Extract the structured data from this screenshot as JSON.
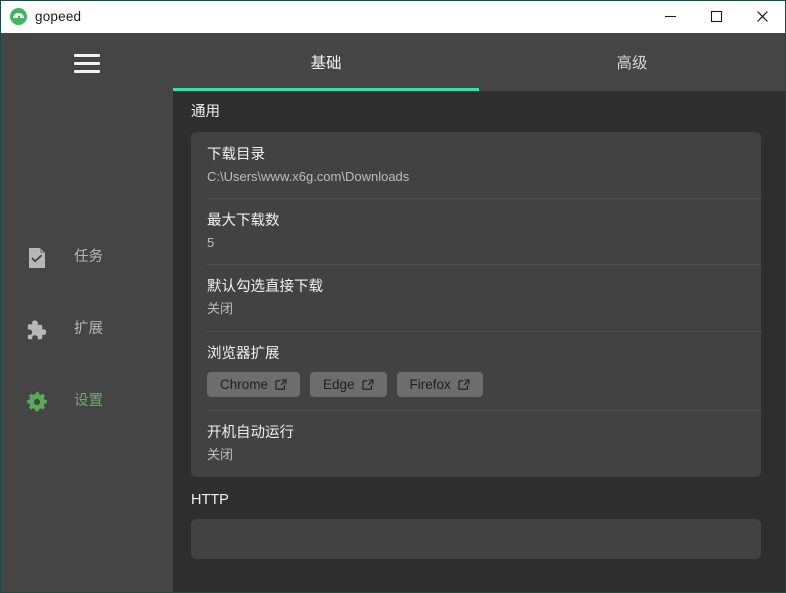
{
  "window": {
    "title": "gopeed",
    "logo_icon": "gopeed-logo-icon",
    "controls": {
      "minimize": "minimize-icon",
      "maximize": "maximize-icon",
      "close": "close-icon"
    }
  },
  "sidebar": {
    "menu_icon": "hamburger-menu-icon",
    "items": [
      {
        "label": "任务",
        "icon": "document-check-icon",
        "active": false
      },
      {
        "label": "扩展",
        "icon": "puzzle-piece-icon",
        "active": false
      },
      {
        "label": "设置",
        "icon": "gear-icon",
        "active": true
      }
    ]
  },
  "tabs": [
    {
      "label": "基础",
      "active": true
    },
    {
      "label": "高级",
      "active": false
    }
  ],
  "sections": [
    {
      "title": "通用",
      "rows": [
        {
          "title": "下载目录",
          "value": "C:\\Users\\www.x6g.com\\Downloads"
        },
        {
          "title": "最大下载数",
          "value": "5"
        },
        {
          "title": "默认勾选直接下载",
          "value": "关闭"
        },
        {
          "title": "浏览器扩展",
          "buttons": [
            {
              "label": "Chrome",
              "icon": "external-link-icon"
            },
            {
              "label": "Edge",
              "icon": "external-link-icon"
            },
            {
              "label": "Firefox",
              "icon": "external-link-icon"
            }
          ]
        },
        {
          "title": "开机自动运行",
          "value": "关闭"
        }
      ]
    },
    {
      "title": "HTTP",
      "rows": []
    }
  ],
  "colors": {
    "accent": "#35e0ad",
    "active_nav": "#68b068",
    "sidebar_bg": "#454545",
    "content_bg": "#2e2e2e",
    "card_bg": "#424242"
  }
}
